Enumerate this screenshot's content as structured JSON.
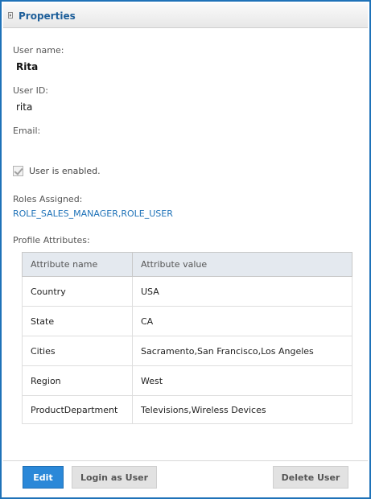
{
  "panel": {
    "title": "Properties"
  },
  "fields": {
    "username_label": "User name:",
    "username_value": "Rita",
    "userid_label": "User ID:",
    "userid_value": "rita",
    "email_label": "Email:",
    "email_value": "",
    "enabled_label": "User is enabled.",
    "enabled_checked": true,
    "roles_label": "Roles Assigned:",
    "roles_value": "ROLE_SALES_MANAGER,ROLE_USER",
    "profile_label": "Profile Attributes:"
  },
  "attributes": {
    "headers": [
      "Attribute name",
      "Attribute value"
    ],
    "rows": [
      [
        "Country",
        "USA"
      ],
      [
        "State",
        "CA"
      ],
      [
        "Cities",
        "Sacramento,San Francisco,Los Angeles"
      ],
      [
        "Region",
        "West"
      ],
      [
        "ProductDepartment",
        "Televisions,Wireless Devices"
      ]
    ]
  },
  "buttons": {
    "edit": "Edit",
    "login_as_user": "Login as User",
    "delete_user": "Delete User"
  },
  "colors": {
    "accent": "#1e72b8",
    "primary_button": "#2b88d8",
    "header_bg": "#e4e9ef"
  }
}
